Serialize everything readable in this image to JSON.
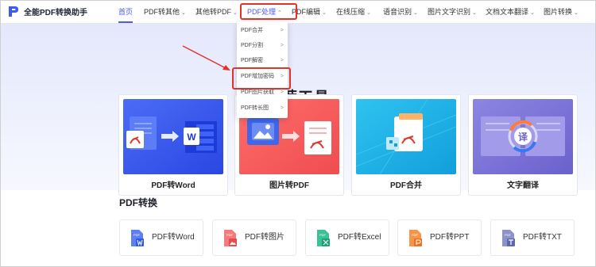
{
  "app": {
    "name": "全能PDF转换助手"
  },
  "nav": {
    "items": [
      {
        "label": "首页",
        "caret": "",
        "state": "active"
      },
      {
        "label": "PDF转其他",
        "caret": "⌄",
        "state": ""
      },
      {
        "label": "其他转PDF",
        "caret": "⌄",
        "state": ""
      },
      {
        "label": "PDF处理",
        "caret": "⌃",
        "state": "open"
      },
      {
        "label": "PDF编辑",
        "caret": "⌄",
        "state": ""
      },
      {
        "label": "在线压缩",
        "caret": "⌄",
        "state": ""
      },
      {
        "label": "语音识别",
        "caret": "⌄",
        "state": ""
      },
      {
        "label": "图片文字识别",
        "caret": "⌄",
        "state": ""
      },
      {
        "label": "文档文本翻译",
        "caret": "⌄",
        "state": ""
      },
      {
        "label": "图片转换",
        "caret": "⌄",
        "state": ""
      }
    ]
  },
  "dropdown": {
    "items": [
      {
        "label": "PDF合并",
        "arrow": ">"
      },
      {
        "label": "PDF分割",
        "arrow": ">"
      },
      {
        "label": "PDF解密",
        "arrow": ">"
      },
      {
        "label": "PDF增加密码",
        "arrow": ">"
      },
      {
        "label": "PDF图片获取",
        "arrow": ">"
      },
      {
        "label": "PDF转长图",
        "arrow": ">"
      }
    ]
  },
  "hero": {
    "title": "推荐工具"
  },
  "cards": [
    {
      "label": "PDF转Word",
      "icon": "pdf-to-word-illustration"
    },
    {
      "label": "图片转PDF",
      "icon": "image-to-pdf-illustration"
    },
    {
      "label": "PDF合并",
      "icon": "pdf-merge-illustration"
    },
    {
      "label": "文字翻译",
      "icon": "text-translate-illustration"
    }
  ],
  "section": {
    "title": "PDF转换",
    "items": [
      {
        "label": "PDF转Word",
        "icon": "pdf-word-icon"
      },
      {
        "label": "PDF转图片",
        "icon": "pdf-image-icon"
      },
      {
        "label": "PDF转Excel",
        "icon": "pdf-excel-icon"
      },
      {
        "label": "PDF转PPT",
        "icon": "pdf-ppt-icon"
      },
      {
        "label": "PDF转TXT",
        "icon": "pdf-txt-icon"
      }
    ]
  },
  "colors": {
    "accent": "#4a59f0",
    "highlight": "#e0342b",
    "word_blue": "#2f5bea",
    "image_red": "#f0595a",
    "merge_cyan": "#19b3e6",
    "translate_purple": "#7b74d6"
  },
  "icon_glyphs": {
    "translate_char": "译",
    "pdf_tag": "PDF",
    "word_tag": "W"
  }
}
